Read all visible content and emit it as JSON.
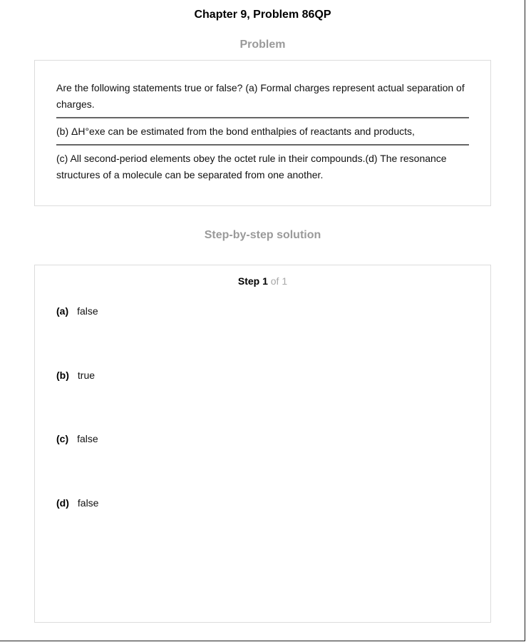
{
  "header": {
    "title": "Chapter 9, Problem 86QP"
  },
  "problem": {
    "heading": "Problem",
    "part1": "Are the following statements true or false? (a) Formal charges represent actual separation of charges.",
    "part2": "(b) ΔH°exe can be estimated from the bond enthalpies of reactants and products,",
    "part3": "(c) All second-period elements obey the octet rule in their compounds.(d) The resonance structures of a molecule can be separated from one another."
  },
  "solution": {
    "heading": "Step-by-step solution",
    "step_label": "Step 1",
    "step_of": "of 1",
    "answers": [
      {
        "key": "(a)",
        "value": "false"
      },
      {
        "key": "(b)",
        "value": "true"
      },
      {
        "key": "(c)",
        "value": "false"
      },
      {
        "key": "(d)",
        "value": "false"
      }
    ]
  }
}
